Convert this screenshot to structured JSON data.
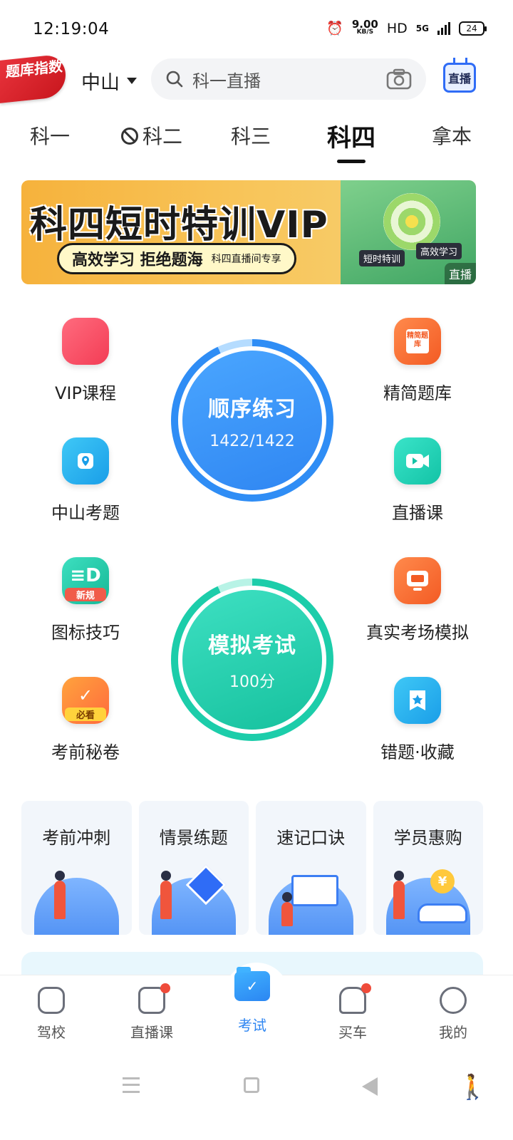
{
  "status": {
    "time": "12:19:04",
    "net_speed_value": "9.00",
    "net_speed_unit": "KB/S",
    "hd": "HD",
    "network": "5G",
    "battery": "24"
  },
  "header": {
    "brand_badge": "题库指数",
    "city": "中山",
    "search_placeholder": "科一直播",
    "live_label": "直播"
  },
  "tabs": [
    {
      "label": "科一"
    },
    {
      "label": "科二"
    },
    {
      "label": "科三"
    },
    {
      "label": "科四",
      "active": true
    },
    {
      "label": "拿本"
    }
  ],
  "banner": {
    "title": "科四短时特训VIP",
    "pill_main": "高效学习 拒绝题海",
    "pill_sub": "科四直播间专享",
    "tag_short": "短时特训",
    "tag_efficient": "高效学习",
    "live": "直播"
  },
  "features": {
    "vip": "VIP课程",
    "jingjian": "精简题库",
    "jingjian_icon_text": "精简题库",
    "zhongshan": "中山考题",
    "zhibo": "直播课",
    "tubiao": "图标技巧",
    "tubiao_tag": "新规",
    "zhenshi": "真实考场模拟",
    "kaoqian": "考前秘卷",
    "kaoqian_tag": "必看",
    "cuoti": "错题·收藏"
  },
  "circles": {
    "sequence_title": "顺序练习",
    "sequence_progress": "1422/1422",
    "mock_title": "模拟考试",
    "mock_score": "100分"
  },
  "cards": [
    {
      "title": "考前冲刺"
    },
    {
      "title": "情景练题"
    },
    {
      "title": "速记口诀"
    },
    {
      "title": "学员惠购"
    }
  ],
  "card_coin": "¥",
  "nav": {
    "school": "驾校",
    "live": "直播课",
    "exam": "考试",
    "buy_car": "买车",
    "mine": "我的"
  },
  "colors": {
    "accent": "#2f86f2",
    "mock_green": "#16c19e",
    "badge_red": "#ef4b3a"
  }
}
